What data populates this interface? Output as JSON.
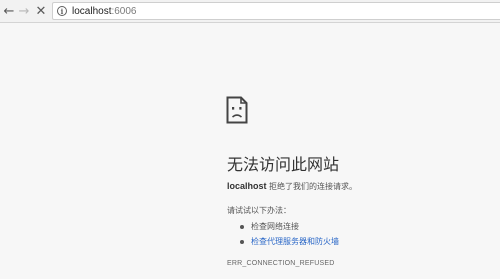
{
  "toolbar": {
    "back_icon": "arrow-left-icon",
    "forward_icon": "arrow-right-icon",
    "stop_icon": "close-icon",
    "site_info_icon": "info-icon",
    "url_host": "localhost",
    "url_port": ":6006"
  },
  "error_page": {
    "icon": "sad-page-icon",
    "title": "无法访问此网站",
    "host": "localhost",
    "description": " 拒绝了我们的连接请求。",
    "try_label": "请试试以下办法：",
    "suggestions": [
      {
        "label": "检查网络连接",
        "is_link": false
      },
      {
        "label": "检查代理服务器和防火墙",
        "is_link": true
      }
    ],
    "error_code": "ERR_CONNECTION_REFUSED"
  },
  "colors": {
    "link": "#2a67c7",
    "page_background": "#f7f7f7",
    "toolbar_background": "#f2f2f2"
  }
}
